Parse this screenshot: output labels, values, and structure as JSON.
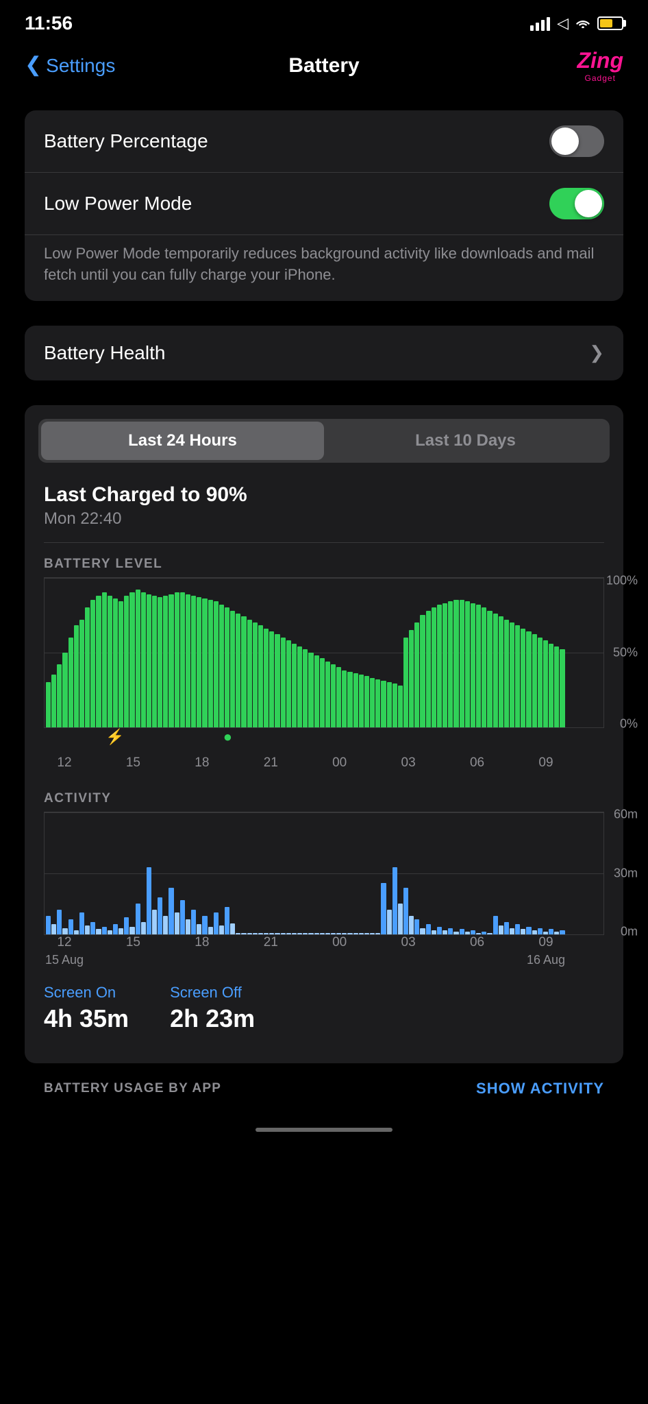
{
  "statusBar": {
    "time": "11:56",
    "batteryColor": "#f5c518"
  },
  "nav": {
    "backLabel": "Settings",
    "title": "Battery",
    "logoText": "Zing",
    "logoSub": "Gadget"
  },
  "settings": {
    "batteryPercentage": {
      "label": "Battery Percentage",
      "toggleState": "off"
    },
    "lowPowerMode": {
      "label": "Low Power Mode",
      "toggleState": "on",
      "description": "Low Power Mode temporarily reduces background activity like downloads and mail fetch until you can fully charge your iPhone."
    }
  },
  "batteryHealth": {
    "label": "Battery Health"
  },
  "chartSection": {
    "tabs": [
      "Last 24 Hours",
      "Last 10 Days"
    ],
    "activeTab": 0,
    "chargeInfo": {
      "title": "Last Charged to 90%",
      "subtitle": "Mon 22:40"
    },
    "batteryLevelLabel": "BATTERY LEVEL",
    "yLabels": [
      "100%",
      "50%",
      "0%"
    ],
    "xLabels": [
      "12",
      "15",
      "18",
      "21",
      "00",
      "03",
      "06",
      "09"
    ],
    "activityLabel": "ACTIVITY",
    "activityYLabels": [
      "60m",
      "30m",
      "0m"
    ],
    "activityXLabels": [
      "12",
      "15",
      "18",
      "21",
      "00",
      "03",
      "06",
      "09"
    ],
    "dateLabels": [
      "15 Aug",
      "",
      "",
      "",
      "16 Aug",
      "",
      "",
      ""
    ],
    "screenOn": {
      "label": "Screen On",
      "value": "4h 35m"
    },
    "screenOff": {
      "label": "Screen Off",
      "value": "2h 23m"
    }
  },
  "footer": {
    "usageLabel": "BATTERY USAGE BY APP",
    "showActivityLabel": "SHOW ACTIVITY"
  }
}
